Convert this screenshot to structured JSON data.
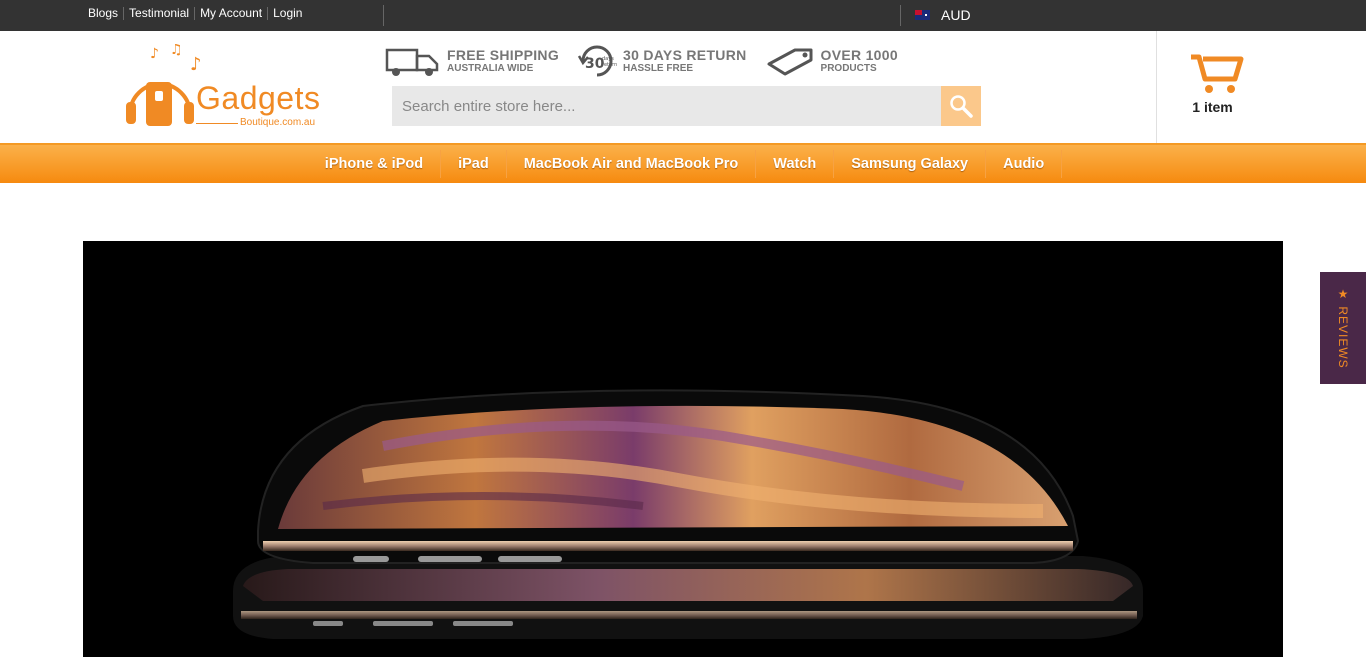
{
  "topbar": {
    "links": [
      "Blogs",
      "Testimonial",
      "My Account",
      "Login"
    ],
    "currency": "AUD"
  },
  "logo": {
    "name": "Gadgets",
    "sub": "Boutique.com.au"
  },
  "features": [
    {
      "title": "FREE SHIPPING",
      "sub": "AUSTRALIA WIDE",
      "icon": "truck-icon"
    },
    {
      "title": "30 DAYS RETURN",
      "sub": "HASSLE FREE",
      "icon": "return-icon"
    },
    {
      "title": "OVER 1000",
      "sub": "PRODUCTS",
      "icon": "tag-icon"
    }
  ],
  "return_badge": {
    "big": "30",
    "small_top": "days",
    "small_bottom": "return"
  },
  "search": {
    "placeholder": "Search entire store here..."
  },
  "cart": {
    "label": "1 item"
  },
  "nav": [
    "iPhone & iPod",
    "iPad",
    "MacBook Air and MacBook Pro",
    "Watch",
    "Samsung Galaxy",
    "Audio"
  ],
  "reviews_tab": {
    "label": "★ REVIEWS"
  },
  "colors": {
    "brand": "#f08a24",
    "topbar": "#333333",
    "nav_top": "#fbb14a",
    "nav_bottom": "#f68a0f",
    "reviews_bg": "#4a2848"
  }
}
